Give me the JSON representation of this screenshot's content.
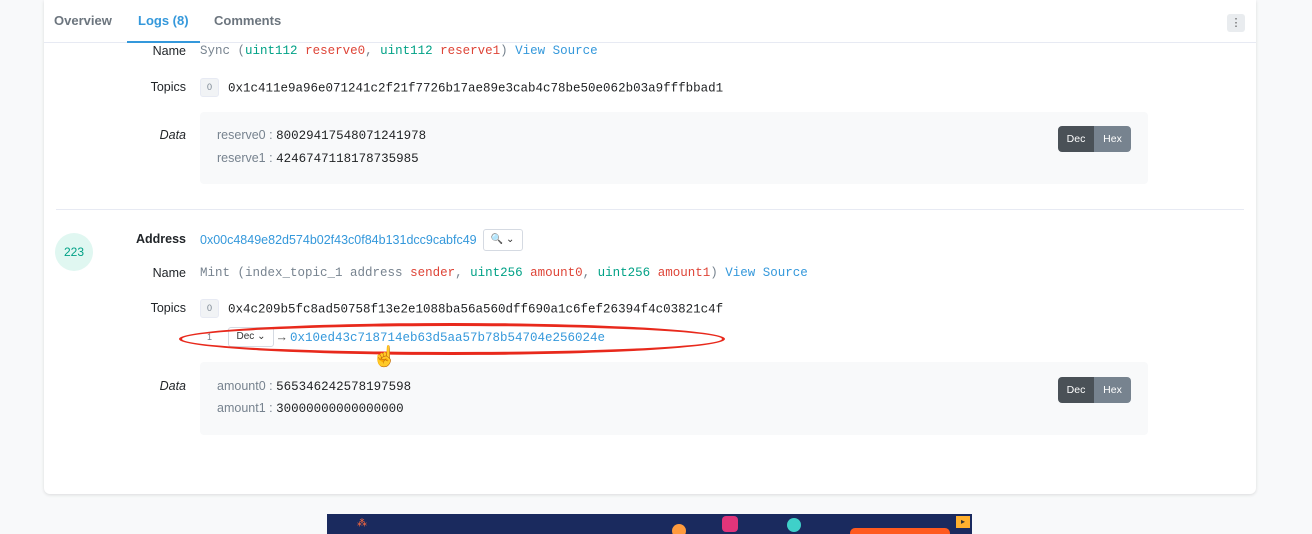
{
  "tabs": [
    {
      "label": "Overview"
    },
    {
      "label": "Logs (8)"
    },
    {
      "label": "Comments"
    }
  ],
  "more_label": "⋮",
  "log1": {
    "name_label": "Name",
    "fn_name": "Sync",
    "params": [
      {
        "type": "uint112",
        "name": "reserve0"
      },
      {
        "type": "uint112",
        "name": "reserve1"
      }
    ],
    "view_source": "View Source",
    "topics_label": "Topics",
    "topics": [
      {
        "index": "0",
        "value": "0x1c411e9a96e071241c2f21f7726b17ae89e3cab4c78be50e062b03a9fffbbad1"
      }
    ],
    "data_label": "Data",
    "data": [
      {
        "key": "reserve0 :",
        "value": "800294175480712419​78"
      },
      {
        "key": "reserve1 :",
        "value": "4246747118178735985"
      }
    ],
    "dec_label": "Dec",
    "hex_label": "Hex"
  },
  "log2": {
    "badge": "223",
    "address_label": "Address",
    "address": "0x00c4849e82d574b02f43c0f84b131dcc9cabfc49",
    "zoom_label": "🔍 ⌄",
    "name_label": "Name",
    "fn_name": "Mint",
    "params": [
      {
        "type": "index_topic_1 address",
        "name": "sender"
      },
      {
        "type": "uint256",
        "name": "amount0"
      },
      {
        "type": "uint256",
        "name": "amount1"
      }
    ],
    "view_source": "View Source",
    "topics_label": "Topics",
    "topic0": {
      "index": "0",
      "value": "0x4c209b5fc8ad50758f13e2e1088ba56a560dff690a1c6fef26394f4c03821c4f"
    },
    "topic1": {
      "index": "1",
      "select": "Dec ⌄",
      "arrow": "→",
      "value": "0x10ed43c718714eb63d5aa57b78b54704e256024e"
    },
    "data_label": "Data",
    "data": [
      {
        "key": "amount0 :",
        "value": "565346242578197598"
      },
      {
        "key": "amount1 :",
        "value": "30000000000000000"
      }
    ],
    "dec_label": "Dec",
    "hex_label": "Hex"
  },
  "colors": {
    "accent": "#3498db",
    "param_type": "#00a186",
    "param_name": "#de4437",
    "annotation": "#e8291c"
  }
}
